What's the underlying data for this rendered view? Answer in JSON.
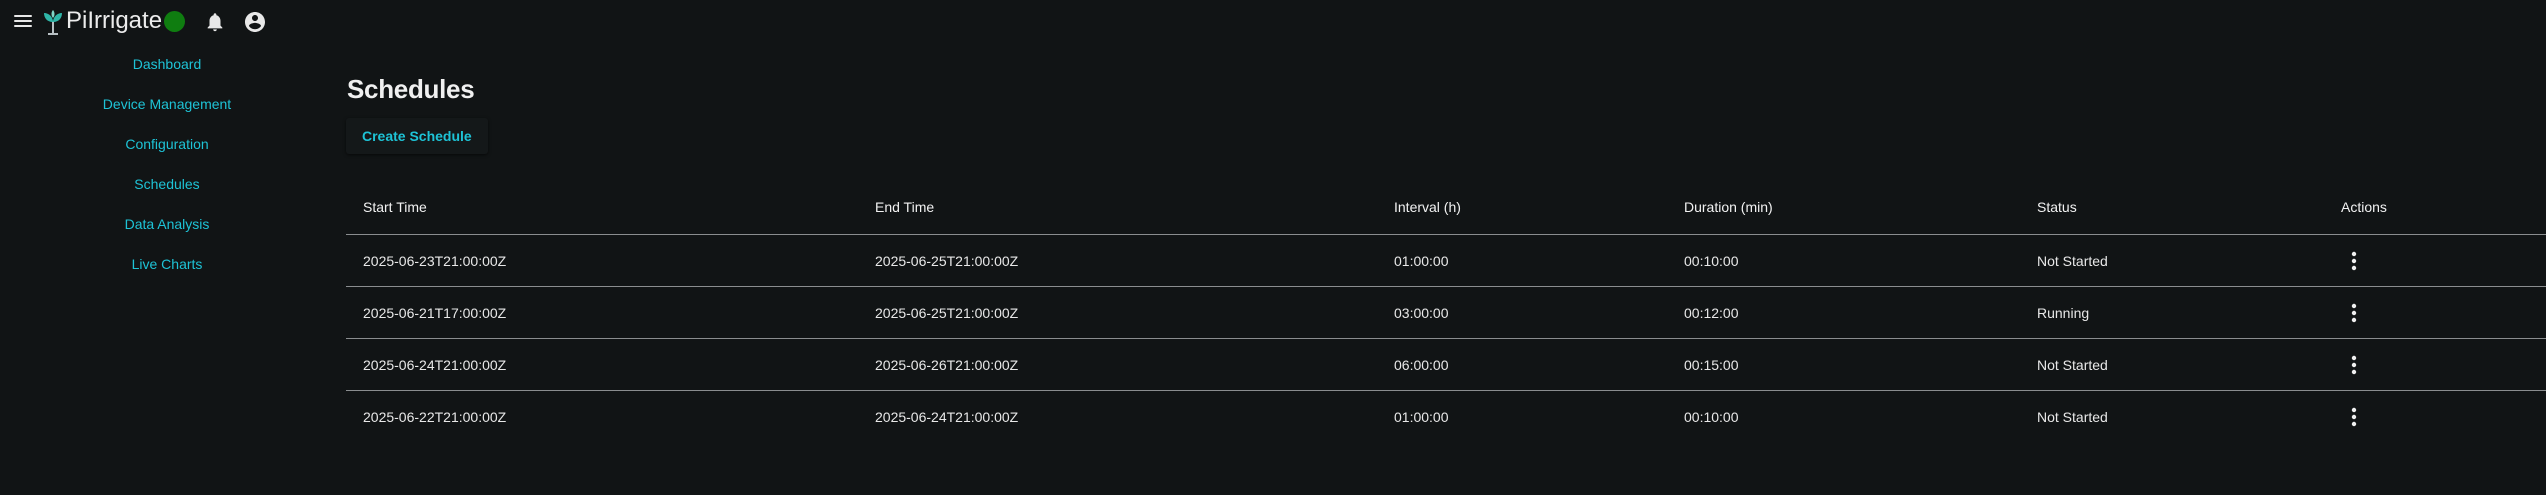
{
  "app": {
    "title": "PiIrrigate",
    "status_color": "#0f7d10",
    "accent_color": "#1ec3d6"
  },
  "icons": {
    "menu": "hamburger-menu-icon",
    "logo": "sprout-logo-icon",
    "status": "status-dot-icon",
    "notifications": "bell-icon",
    "account": "account-circle-icon",
    "row_actions": "more-vertical-icon"
  },
  "sidebar": {
    "items": [
      {
        "label": "Dashboard"
      },
      {
        "label": "Device Management"
      },
      {
        "label": "Configuration"
      },
      {
        "label": "Schedules"
      },
      {
        "label": "Data Analysis"
      },
      {
        "label": "Live Charts"
      }
    ]
  },
  "main": {
    "title": "Schedules",
    "create_button": "Create Schedule"
  },
  "table": {
    "columns": [
      "Start Time",
      "End Time",
      "Interval (h)",
      "Duration (min)",
      "Status",
      "Actions"
    ],
    "rows": [
      {
        "start": "2025-06-23T21:00:00Z",
        "end": "2025-06-25T21:00:00Z",
        "interval": "01:00:00",
        "duration": "00:10:00",
        "status": "Not Started"
      },
      {
        "start": "2025-06-21T17:00:00Z",
        "end": "2025-06-25T21:00:00Z",
        "interval": "03:00:00",
        "duration": "00:12:00",
        "status": "Running"
      },
      {
        "start": "2025-06-24T21:00:00Z",
        "end": "2025-06-26T21:00:00Z",
        "interval": "06:00:00",
        "duration": "00:15:00",
        "status": "Not Started"
      },
      {
        "start": "2025-06-22T21:00:00Z",
        "end": "2025-06-24T21:00:00Z",
        "interval": "01:00:00",
        "duration": "00:10:00",
        "status": "Not Started"
      }
    ]
  }
}
